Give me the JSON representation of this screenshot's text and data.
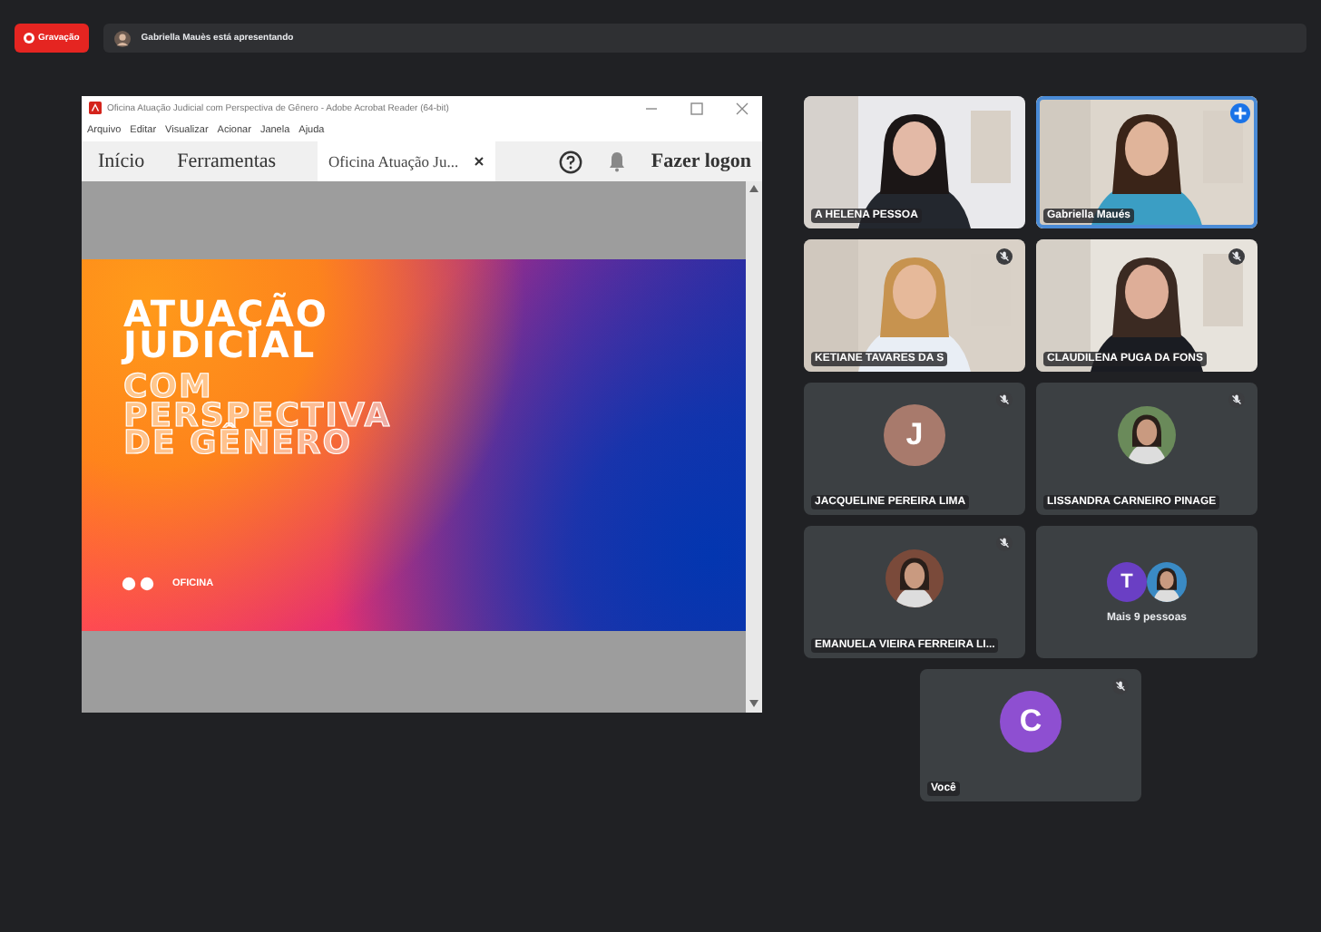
{
  "recording": {
    "label": "Gravação"
  },
  "presenter": {
    "text": "Gabriella Mauès está apresentando"
  },
  "shared_window": {
    "title": "Oficina Atuação Judicial com Perspectiva de Gênero - Adobe Acrobat Reader (64-bit)",
    "menu": [
      "Arquivo",
      "Editar",
      "Visualizar",
      "Acionar",
      "Janela",
      "Ajuda"
    ],
    "toolbar": {
      "home": "Início",
      "tools": "Ferramentas",
      "doc_tab": "Oficina Atuação Ju...",
      "sign_in": "Fazer logon"
    },
    "slide": {
      "title_lines": [
        "ATUAÇÃO",
        "JUDICIAL"
      ],
      "subtitle_lines": [
        "COM",
        "PERSPECTIVA",
        "DE GÊNERO"
      ],
      "tag": "OFICINA"
    }
  },
  "tiles": [
    {
      "kind": "video",
      "name": "A HELENA PESSOA",
      "speaking": false,
      "pinned": false,
      "muted": false
    },
    {
      "kind": "video",
      "name": "Gabriella Maués",
      "speaking": true,
      "pinned": true,
      "muted": false
    },
    {
      "kind": "video",
      "name": "KETIANE TAVARES DA S",
      "speaking": false,
      "pinned": false,
      "muted": true
    },
    {
      "kind": "video",
      "name": "CLAUDILENA PUGA DA FONS",
      "speaking": false,
      "pinned": false,
      "muted": true
    },
    {
      "kind": "letter",
      "name": "JACQUELINE PEREIRA LIMA",
      "letter": "J",
      "color": "#a87a6c",
      "muted": true
    },
    {
      "name": "LISSANDRA CARNEIRO PINAGE",
      "muted": true
    },
    {
      "name": "EMANUELA VIEIRA FERREIRA LI...",
      "muted": true
    },
    {
      "kind": "more",
      "label": "Mais 9 pessoas",
      "letter": "T",
      "color": "#6a3fc4"
    },
    {
      "kind": "letter",
      "name": "Você",
      "letter": "C",
      "color": "#8e4fd1",
      "muted": true
    }
  ]
}
